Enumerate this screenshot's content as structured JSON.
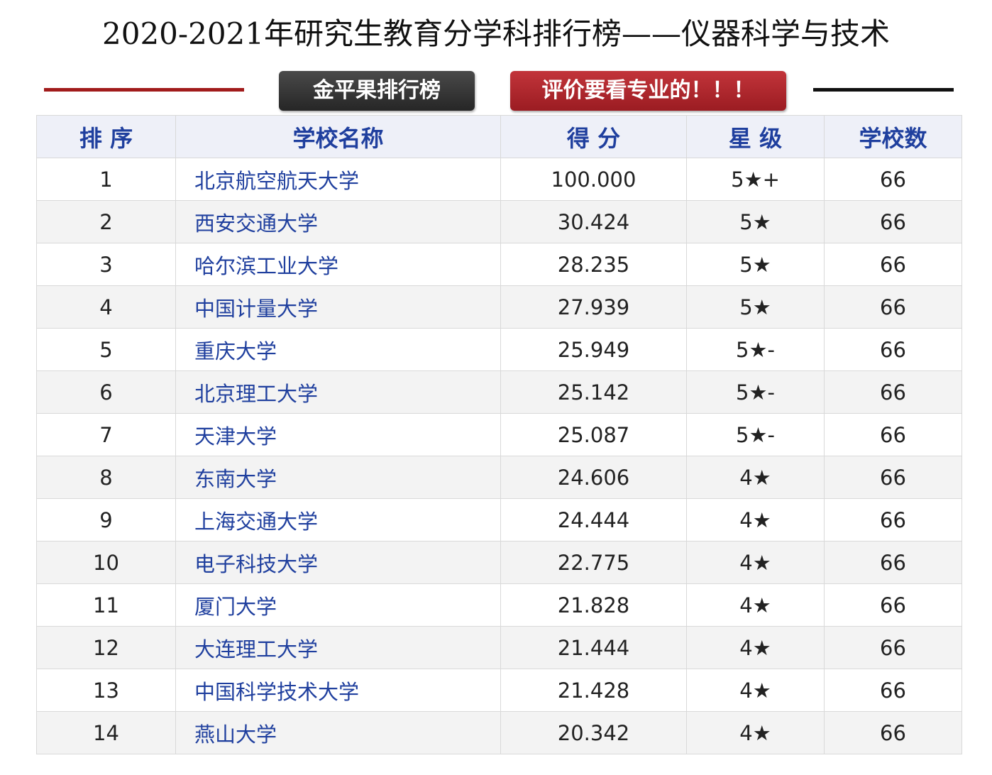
{
  "title": "2020-2021年研究生教育分学科排行榜——仪器科学与技术",
  "badges": {
    "brand": "金平果排行榜",
    "slogan": "评价要看专业的！！！"
  },
  "colors": {
    "header_text": "#1f3f9e",
    "school_text": "#1f3f9e",
    "rule_left": "#a11b1b",
    "rule_right": "#111111",
    "brand_badge": "#333333",
    "slogan_badge": "#b0282e"
  },
  "table": {
    "columns": [
      "排 序",
      "学校名称",
      "得 分",
      "星 级",
      "学校数"
    ],
    "rows": [
      {
        "rank": "1",
        "school": "北京航空航天大学",
        "score": "100.000",
        "star": "5★+",
        "count": "66"
      },
      {
        "rank": "2",
        "school": "西安交通大学",
        "score": "30.424",
        "star": "5★",
        "count": "66"
      },
      {
        "rank": "3",
        "school": "哈尔滨工业大学",
        "score": "28.235",
        "star": "5★",
        "count": "66"
      },
      {
        "rank": "4",
        "school": "中国计量大学",
        "score": "27.939",
        "star": "5★",
        "count": "66"
      },
      {
        "rank": "5",
        "school": "重庆大学",
        "score": "25.949",
        "star": "5★-",
        "count": "66"
      },
      {
        "rank": "6",
        "school": "北京理工大学",
        "score": "25.142",
        "star": "5★-",
        "count": "66"
      },
      {
        "rank": "7",
        "school": "天津大学",
        "score": "25.087",
        "star": "5★-",
        "count": "66"
      },
      {
        "rank": "8",
        "school": "东南大学",
        "score": "24.606",
        "star": "4★",
        "count": "66"
      },
      {
        "rank": "9",
        "school": "上海交通大学",
        "score": "24.444",
        "star": "4★",
        "count": "66"
      },
      {
        "rank": "10",
        "school": "电子科技大学",
        "score": "22.775",
        "star": "4★",
        "count": "66"
      },
      {
        "rank": "11",
        "school": "厦门大学",
        "score": "21.828",
        "star": "4★",
        "count": "66"
      },
      {
        "rank": "12",
        "school": "大连理工大学",
        "score": "21.444",
        "star": "4★",
        "count": "66"
      },
      {
        "rank": "13",
        "school": "中国科学技术大学",
        "score": "21.428",
        "star": "4★",
        "count": "66"
      },
      {
        "rank": "14",
        "school": "燕山大学",
        "score": "20.342",
        "star": "4★",
        "count": "66"
      }
    ]
  }
}
